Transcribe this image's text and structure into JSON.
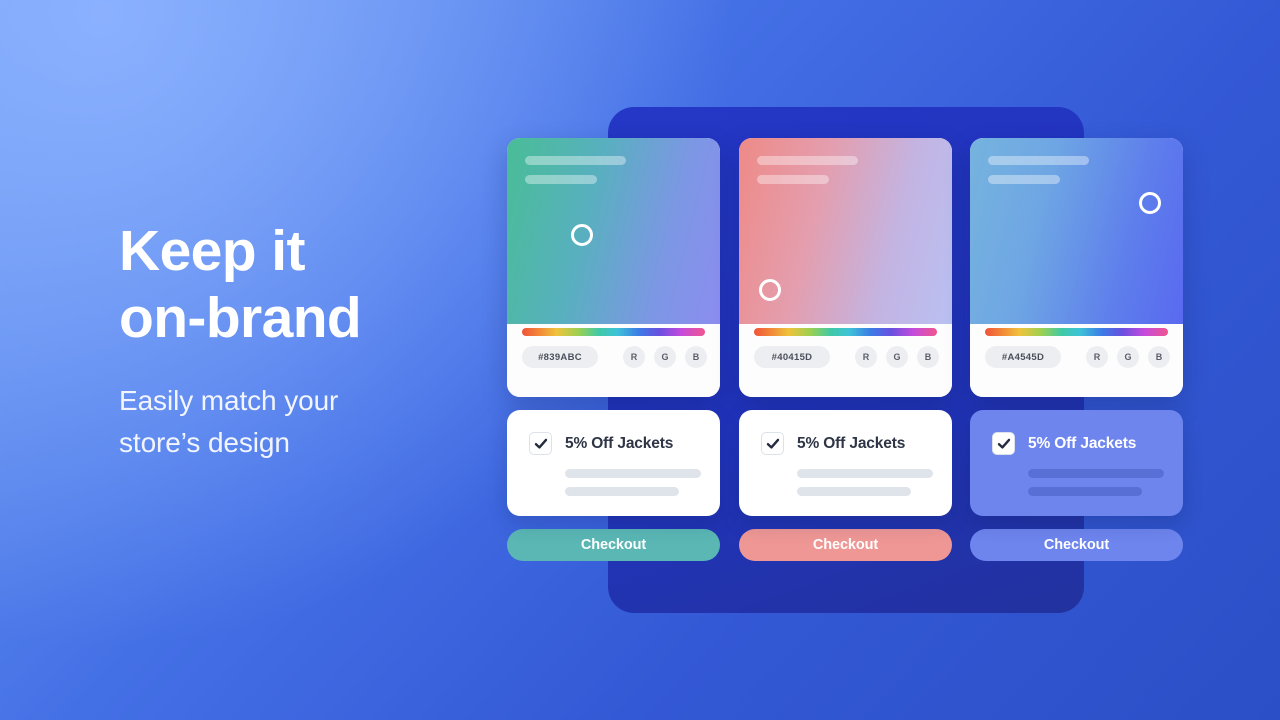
{
  "background": {
    "gradient_from": "#6C9BF2",
    "gradient_to": "#2B4FC6",
    "panel_color": "#2234BE"
  },
  "copy": {
    "headline": "Keep it\non-brand",
    "subcopy": "Easily match your\nstore’s design"
  },
  "columns": [
    {
      "id": "column-1",
      "preview": {
        "gradient_from": "#49BD96",
        "gradient_to": "#8C8DF0",
        "ring_position": "center"
      },
      "swatch": {
        "hex": "#839ABC",
        "channels": [
          "R",
          "G",
          "B"
        ]
      },
      "offer": {
        "title": "5% Off Jackets",
        "checked": true,
        "theme": "light"
      },
      "checkout": {
        "label": "Checkout",
        "color": "#5AB7B4"
      }
    },
    {
      "id": "column-2",
      "preview": {
        "gradient_from": "#EE8A87",
        "gradient_to": "#B9C0F2",
        "ring_position": "lower-left"
      },
      "swatch": {
        "hex": "#40415D",
        "channels": [
          "R",
          "G",
          "B"
        ]
      },
      "offer": {
        "title": "5% Off Jackets",
        "checked": true,
        "theme": "light"
      },
      "checkout": {
        "label": "Checkout",
        "color": "#EE9795"
      }
    },
    {
      "id": "column-3",
      "preview": {
        "gradient_from": "#76B3DE",
        "gradient_to": "#5969F0",
        "ring_position": "upper-right"
      },
      "swatch": {
        "hex": "#A4545D",
        "channels": [
          "R",
          "G",
          "B"
        ]
      },
      "offer": {
        "title": "5% Off Jackets",
        "checked": true,
        "theme": "blue"
      },
      "checkout": {
        "label": "Checkout",
        "color": "#6E85EE"
      }
    }
  ]
}
